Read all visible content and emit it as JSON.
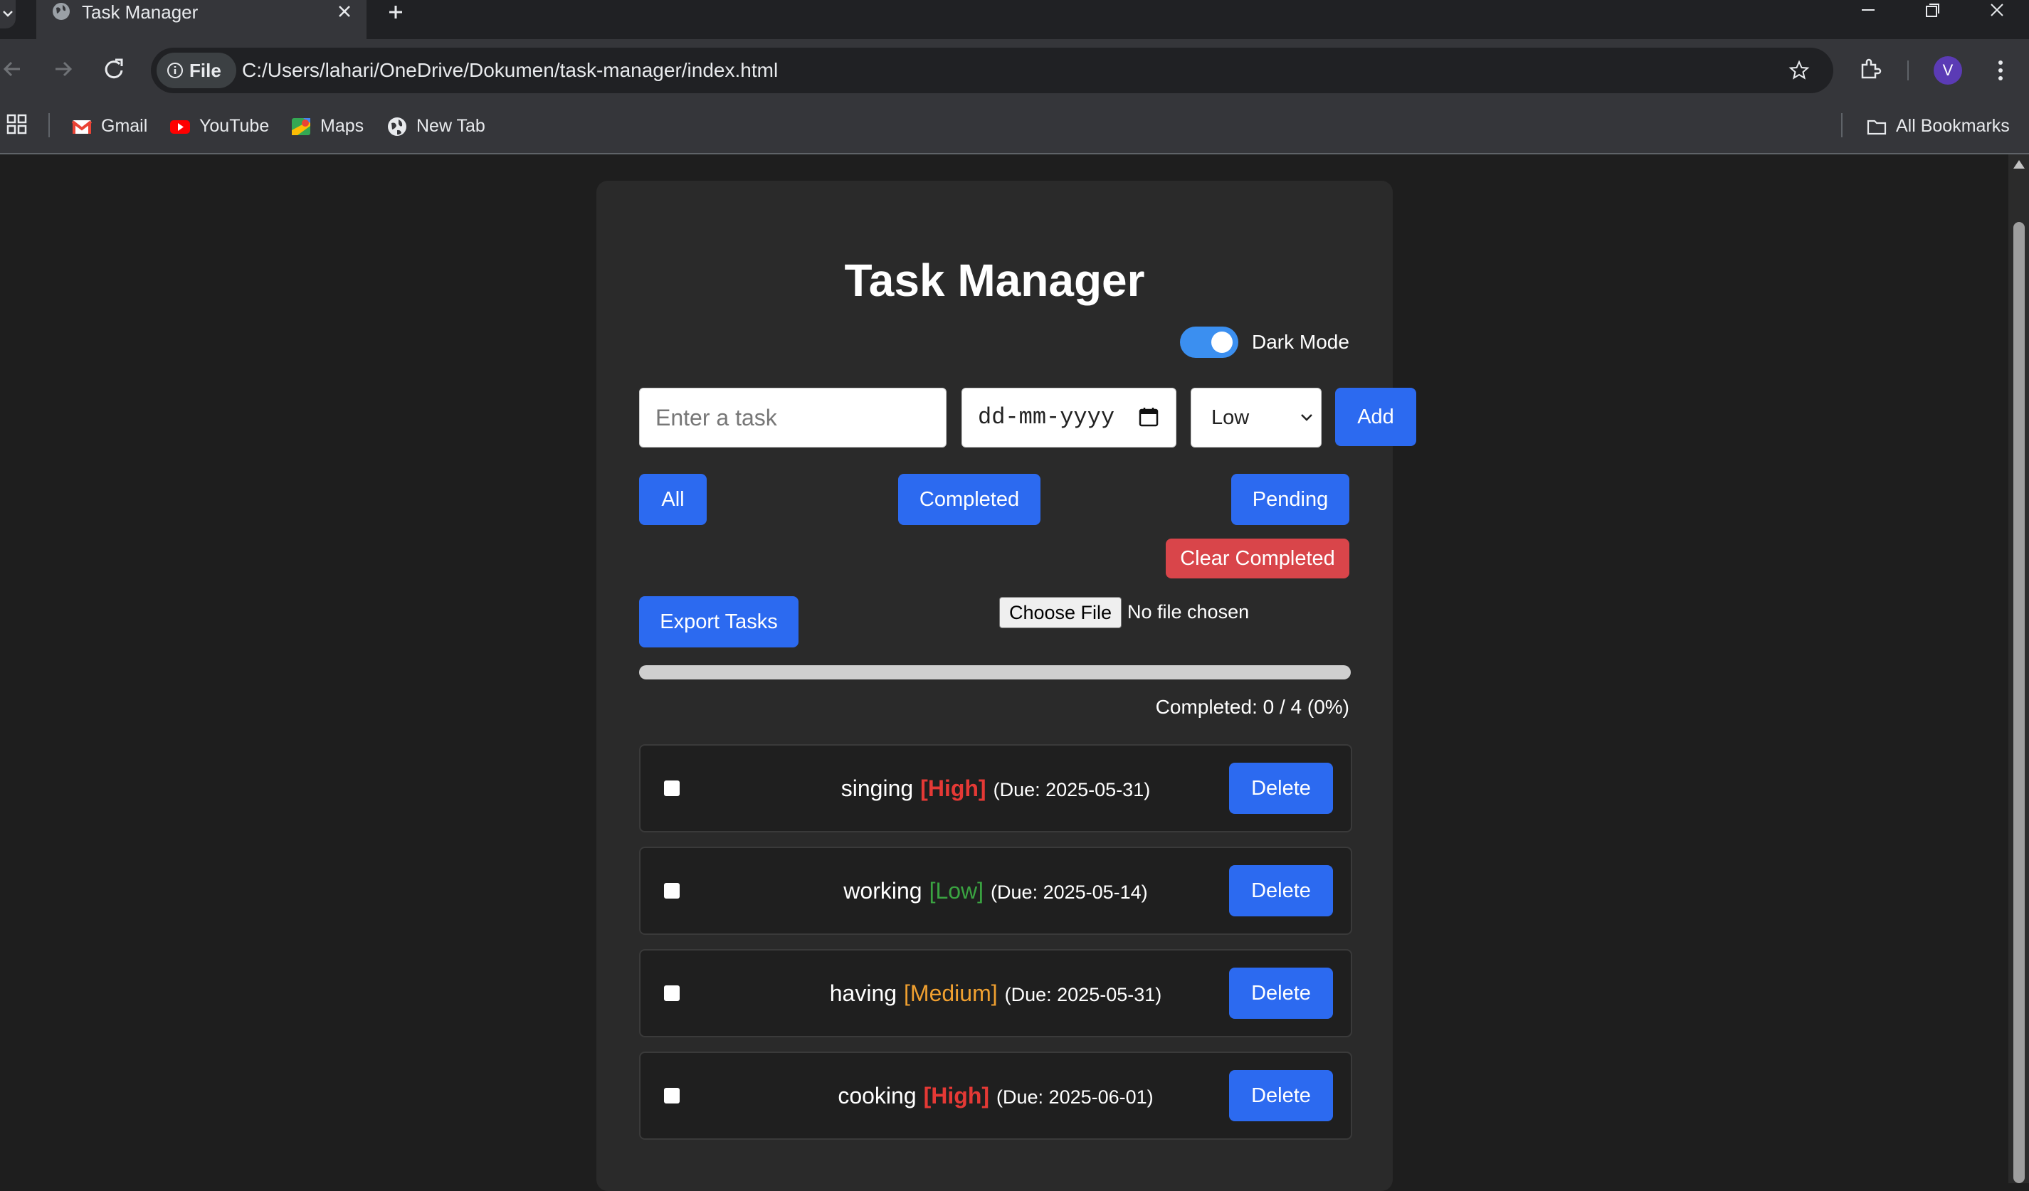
{
  "browser": {
    "tab_title": "Task Manager",
    "site_chip": "File",
    "url": "C:/Users/lahari/OneDrive/Dokumen/task-manager/index.html",
    "profile_initial": "V",
    "bookmarks": [
      {
        "label": "Gmail",
        "icon": "gmail-icon"
      },
      {
        "label": "YouTube",
        "icon": "youtube-icon"
      },
      {
        "label": "Maps",
        "icon": "maps-icon"
      },
      {
        "label": "New Tab",
        "icon": "globe-icon"
      }
    ],
    "all_bookmarks": "All Bookmarks"
  },
  "app": {
    "title": "Task Manager",
    "dark_mode_label": "Dark Mode",
    "dark_mode_on": true,
    "task_placeholder": "Enter a task",
    "date_placeholder": "dd-mm-yyyy",
    "priority_selected": "Low",
    "add_label": "Add",
    "filters": {
      "all": "All",
      "completed": "Completed",
      "pending": "Pending"
    },
    "clear_completed": "Clear Completed",
    "export_label": "Export Tasks",
    "file_button": "Choose File",
    "file_status": "No file chosen",
    "progress_fraction": 0,
    "progress_text": "Completed: 0 / 4 (0%)",
    "delete_label": "Delete",
    "tasks": [
      {
        "name": "singing",
        "priority": "[High]",
        "due": "(Due: 2025-05-31)",
        "done": false
      },
      {
        "name": "working",
        "priority": "[Low]",
        "due": "(Due: 2025-05-14)",
        "done": false
      },
      {
        "name": "having",
        "priority": "[Medium]",
        "due": "(Due: 2025-05-31)",
        "done": false
      },
      {
        "name": "cooking",
        "priority": "[High]",
        "due": "(Due: 2025-06-01)",
        "done": false
      }
    ]
  },
  "colors": {
    "accent": "#2c6af0",
    "danger": "#d9454a",
    "high": "#e53935",
    "medium": "#f0a030",
    "low": "#3aa341"
  }
}
